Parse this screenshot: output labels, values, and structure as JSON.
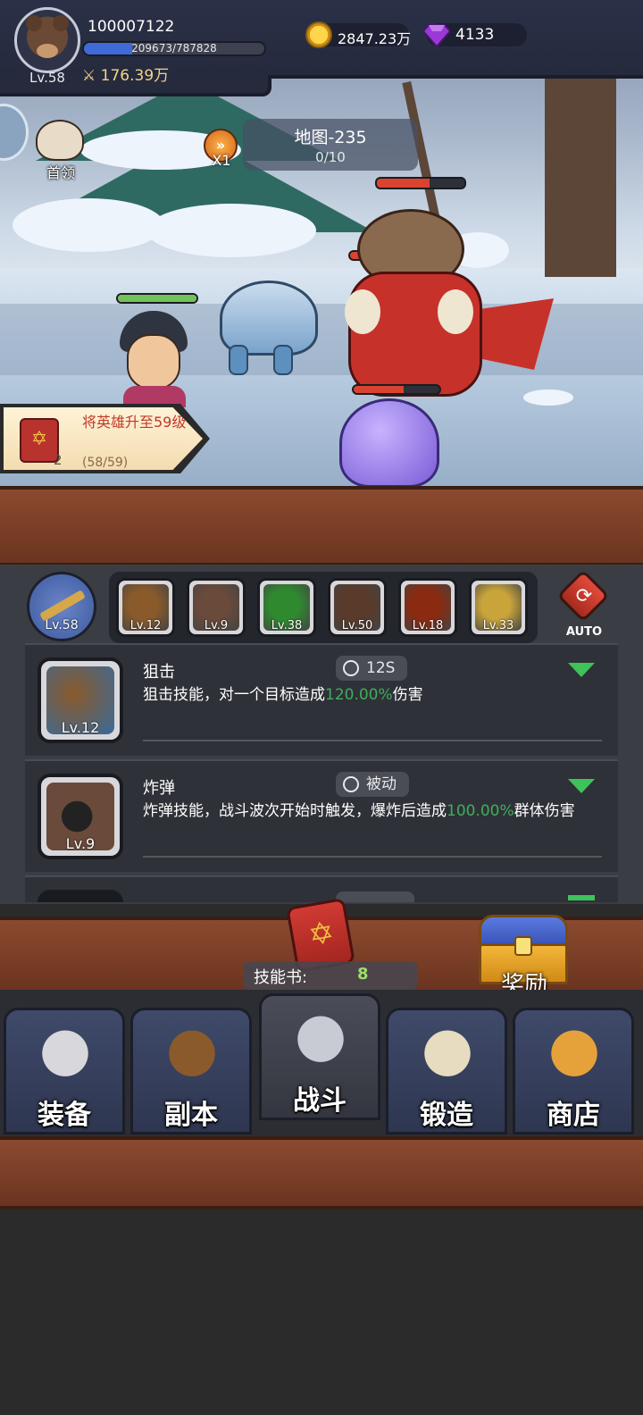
{
  "player": {
    "id": "100007122",
    "level": "Lv.58",
    "exp_text": "209673/787828",
    "exp_fraction": 0.266,
    "power": "176.39万"
  },
  "currency": {
    "gold": "2847.23万",
    "gems": "4133"
  },
  "stage": {
    "boss_label": "首领",
    "speed_label": "X1",
    "map_title": "地图-235",
    "progress": "0/10"
  },
  "quest": {
    "text": "将英雄升至59级",
    "count": "2",
    "progress": "(58/59)"
  },
  "weapon": {
    "level": "Lv.58"
  },
  "skill_slots": [
    {
      "icon": "sniper-skill-icon",
      "level": "Lv.12",
      "color": "#8a5a2a"
    },
    {
      "icon": "bomb-skill-icon",
      "level": "Lv.9",
      "color": "#6a4a3a"
    },
    {
      "icon": "poison-skill-icon",
      "level": "Lv.38",
      "color": "#2f8a2f"
    },
    {
      "icon": "beast-skill-icon",
      "level": "Lv.50",
      "color": "#5a3a2a"
    },
    {
      "icon": "fire-skill-icon",
      "level": "Lv.18",
      "color": "#8a2a10"
    },
    {
      "icon": "lightning-skill-icon",
      "level": "Lv.33",
      "color": "#c9a43a"
    }
  ],
  "auto_label": "AUTO",
  "skills": [
    {
      "name": "狙击",
      "cooldown": "12S",
      "level": "Lv.12",
      "desc_pre": "狙击技能，对一个目标造成",
      "desc_value": "120.00%",
      "desc_post": "伤害"
    },
    {
      "name": "炸弹",
      "cooldown": "被动",
      "level": "Lv.9",
      "desc_pre": "炸弹技能，战斗波次开始时触发，爆炸后造成",
      "desc_value": "100.00%",
      "desc_post": "群体伤害"
    }
  ],
  "skill_book": {
    "label": "技能书:",
    "count": "8"
  },
  "reward_label": "奖励",
  "nav": [
    {
      "label": "装备",
      "icon": "helmet-icon"
    },
    {
      "label": "副本",
      "icon": "dungeon-shield-icon"
    },
    {
      "label": "战斗",
      "icon": "crossed-swords-icon"
    },
    {
      "label": "锻造",
      "icon": "forge-scroll-icon"
    },
    {
      "label": "商店",
      "icon": "shop-icon"
    }
  ],
  "colors": {
    "exp_bar": "#3f6ad8",
    "hp_green": "#74c15a",
    "hp_red": "#d9432f",
    "highlight_green": "#3fae5a",
    "chevron_green": "#3ec25a"
  }
}
